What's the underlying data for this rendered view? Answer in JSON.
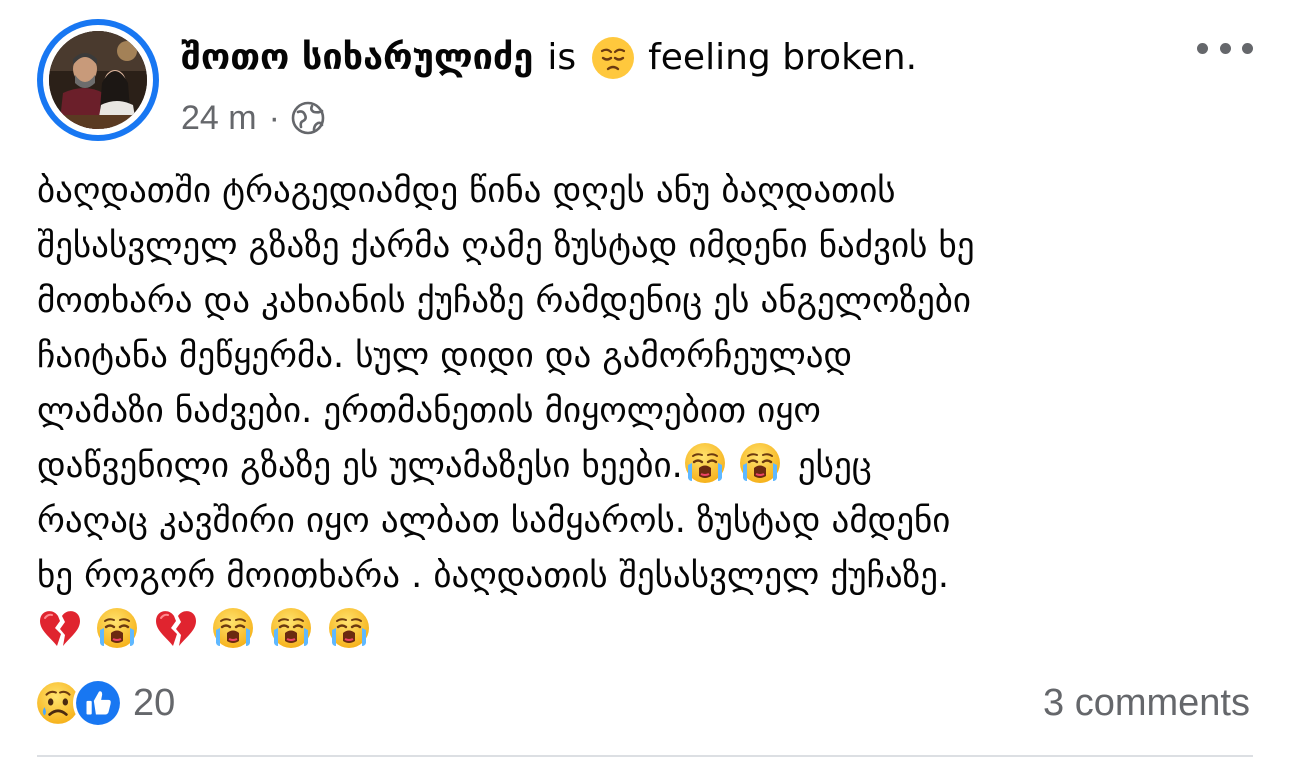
{
  "post": {
    "author": "შოთო სიხარულიძე",
    "is_text": "is",
    "feeling_emoji": "disappointed-face-emoji",
    "feeling_text": "feeling broken.",
    "time": "24 m",
    "separator": "·",
    "audience_icon": "globe-icon",
    "more_icon": "more-options-icon",
    "body_lines": [
      "ბაღდათში ტრაგედიამდე წინა დღეს ანუ ბაღდათის",
      "შესასვლელ გზაზე ქარმა ღამე ზუსტად იმდენი ნაძვის ხე",
      "მოთხარა და კახიანის ქუჩაზე რამდენიც ეს ანგელოზები",
      "ჩაიტანა მეწყერმა. სულ დიდი და გამორჩეულად",
      "ლამაზი ნაძვები. ერთმანეთის მიყოლებით იყო",
      "დაწვენილი გზაზე ეს ულამაზესი ხეები.",
      "ესეც",
      "რაღაც კავშირი იყო ალბათ სამყაროს. ზუსტად ამდენი",
      "ხე როგორ მოითხარა . ბაღდათის შესასვლელ ქუჩაზე."
    ],
    "inline_emojis": [
      "loudly-crying-face-emoji",
      "loudly-crying-face-emoji"
    ],
    "emoji_row": [
      "broken-heart-emoji",
      "loudly-crying-face-emoji",
      "broken-heart-emoji",
      "loudly-crying-face-emoji",
      "loudly-crying-face-emoji",
      "loudly-crying-face-emoji"
    ]
  },
  "footer": {
    "reaction_icons": [
      "sad-reaction-icon",
      "like-reaction-icon"
    ],
    "reaction_count": "20",
    "comments": "3 comments"
  },
  "colors": {
    "accent": "#1877f2",
    "text": "#050505",
    "secondary_text": "#65676b",
    "divider": "#dcdfe3",
    "emoji_yellow": "#ffc83d",
    "heart_red": "#e0242f"
  }
}
